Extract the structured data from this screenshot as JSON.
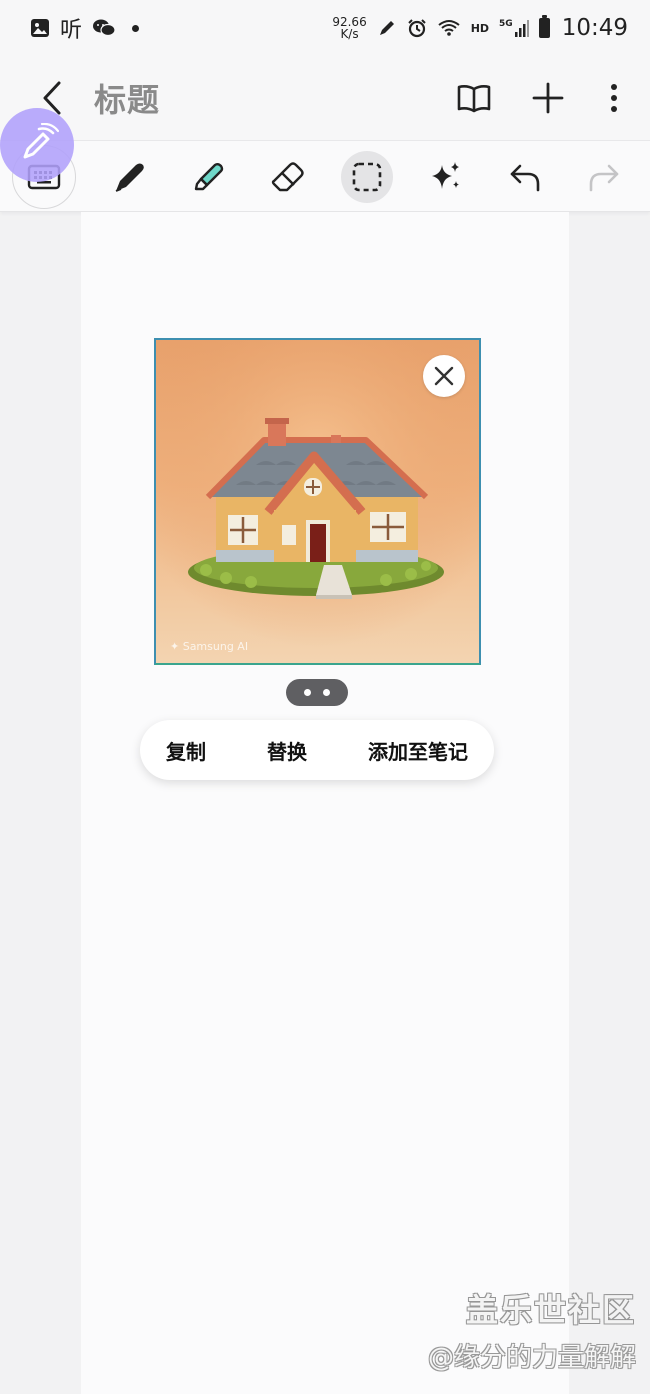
{
  "status_bar": {
    "listen_icon_text": "听",
    "speed_value": "92.66",
    "speed_unit": "K/s",
    "network": "HD",
    "signal": "5G",
    "time": "10:49"
  },
  "header": {
    "title": "标题"
  },
  "toolbar": {
    "tools": [
      "keyboard",
      "pen",
      "highlighter",
      "eraser",
      "lasso-select",
      "ai-assist",
      "undo",
      "redo"
    ],
    "selected_tool": "lasso-select",
    "accent_color": "#6fd8c9",
    "pen_bubble_color": "#b0a0fa"
  },
  "image": {
    "caption_watermark": "✦ Samsung AI"
  },
  "context_menu": {
    "copy_label": "复制",
    "replace_label": "替换",
    "add_to_note_label": "添加至笔记"
  },
  "watermark": {
    "brand": "盖乐世社区",
    "user": "@缘分的力量解解"
  }
}
